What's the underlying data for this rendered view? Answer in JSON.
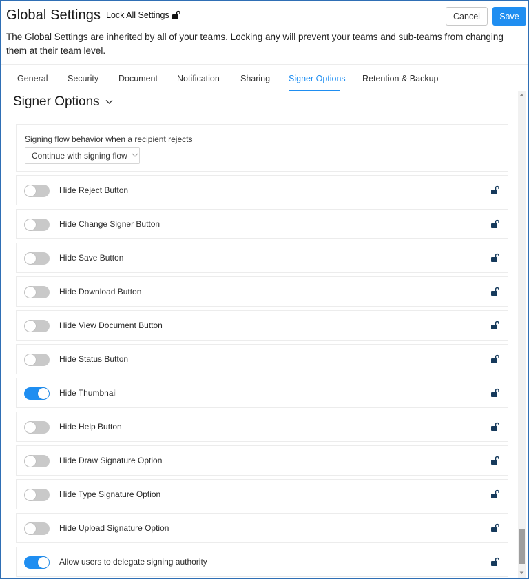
{
  "header": {
    "title": "Global Settings",
    "lock_all_label": "Lock All Settings",
    "cancel_label": "Cancel",
    "save_label": "Save",
    "description": "The Global Settings are inherited by all of your teams. Locking any will prevent your teams and sub-teams from changing them at their team level."
  },
  "tabs": [
    {
      "label": "General",
      "active": false
    },
    {
      "label": "Security",
      "active": false
    },
    {
      "label": "Document",
      "active": false
    },
    {
      "label": "Notification",
      "active": false
    },
    {
      "label": "Sharing",
      "active": false
    },
    {
      "label": "Signer Options",
      "active": true
    },
    {
      "label": "Retention & Backup",
      "active": false
    }
  ],
  "section": {
    "title": "Signer Options"
  },
  "reject_setting": {
    "label": "Signing flow behavior when a recipient rejects",
    "selected": "Continue with signing flow"
  },
  "settings": [
    {
      "label": "Hide Reject Button",
      "enabled": false
    },
    {
      "label": "Hide Change Signer Button",
      "enabled": false
    },
    {
      "label": "Hide Save Button",
      "enabled": false
    },
    {
      "label": "Hide Download Button",
      "enabled": false
    },
    {
      "label": "Hide View Document Button",
      "enabled": false
    },
    {
      "label": "Hide Status Button",
      "enabled": false
    },
    {
      "label": "Hide Thumbnail",
      "enabled": true
    },
    {
      "label": "Hide Help Button",
      "enabled": false
    },
    {
      "label": "Hide Draw Signature Option",
      "enabled": false
    },
    {
      "label": "Hide Type Signature Option",
      "enabled": false
    },
    {
      "label": "Hide Upload Signature Option",
      "enabled": false
    },
    {
      "label": "Allow users to delegate signing authority",
      "enabled": true
    }
  ],
  "colors": {
    "accent": "#1f8ef1",
    "lock_icon": "#163a5c",
    "toggle_off": "#c9c9c9"
  },
  "icons": {
    "lock_all": "unlocked-padlock-icon",
    "row_lock": "unlocked-padlock-icon",
    "section_chevron": "chevron-down-icon",
    "select_chevron": "chevron-down-icon"
  }
}
